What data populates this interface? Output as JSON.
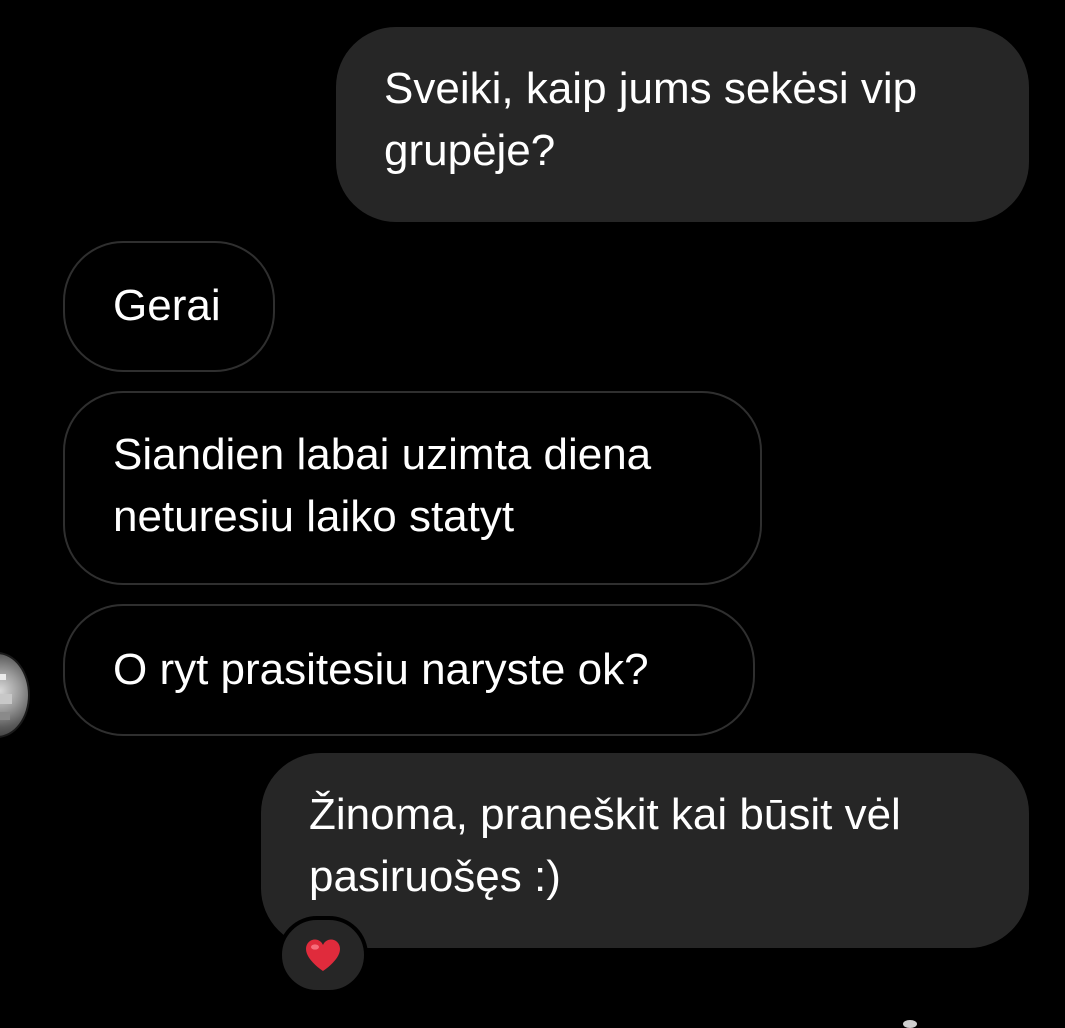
{
  "conversation": {
    "messages": [
      {
        "side": "outgoing",
        "text": "Sveiki, kaip jums sekėsi vip\ngrupėje?"
      },
      {
        "side": "incoming",
        "text": "Gerai"
      },
      {
        "side": "incoming",
        "text": "Siandien labai uzimta diena\nneturesiu laiko statyt"
      },
      {
        "side": "incoming",
        "text": "O ryt prasitesiu naryste ok?"
      },
      {
        "side": "outgoing",
        "text": "Žinoma, praneškit kai būsit vėl\npasiruošęs :)"
      }
    ],
    "reaction": {
      "icon": "heart-icon",
      "color": "#e02b3c"
    }
  },
  "colors": {
    "background": "#000000",
    "outgoing_bubble": "#262626",
    "incoming_border": "#2f2f2f",
    "text": "#ffffff"
  }
}
